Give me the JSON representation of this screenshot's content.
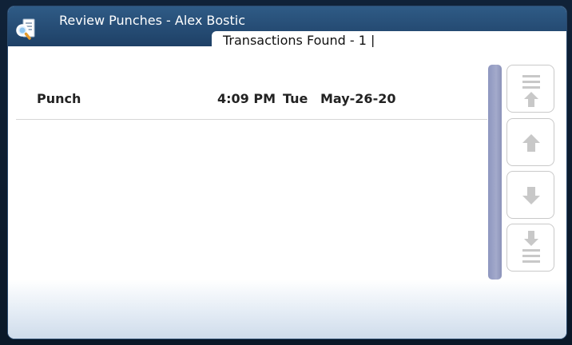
{
  "window": {
    "title": "Review Punches - Alex Bostic",
    "app_icon": "magnifier-document-icon"
  },
  "tab": {
    "label": "Transactions Found - 1 |"
  },
  "transactions": [
    {
      "type": "Punch",
      "time": "4:09 PM",
      "day": "Tue",
      "date": "May-26-20"
    }
  ],
  "scroll_buttons": [
    {
      "icon": "page-up-icon"
    },
    {
      "icon": "arrow-up-icon"
    },
    {
      "icon": "arrow-down-icon"
    },
    {
      "icon": "page-down-icon"
    }
  ],
  "colors": {
    "titlebar": "#1e4066",
    "scrollbar": "#9aa1c6",
    "button_icon": "#c8c8c8"
  }
}
